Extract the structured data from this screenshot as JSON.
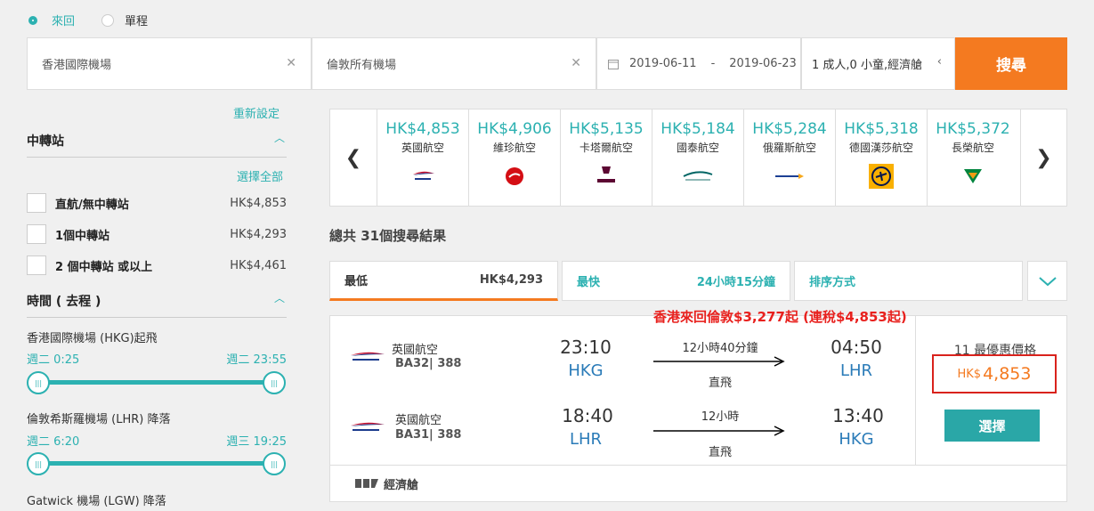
{
  "trip_type": {
    "round": "來回",
    "oneway": "單程"
  },
  "search": {
    "from": "香港國際機場",
    "to": "倫敦所有機場",
    "depart": "2019-06-11",
    "sep": "-",
    "return": "2019-06-23",
    "pax": "1 成人,0 小童,經濟艙",
    "button": "搜尋"
  },
  "sidebar": {
    "reset": "重新設定",
    "stops_title": "中轉站",
    "select_all": "選擇全部",
    "stops": [
      {
        "label": "直航/無中轉站",
        "price": "HK$4,853"
      },
      {
        "label": "1個中轉站",
        "price": "HK$4,293"
      },
      {
        "label": "2 個中轉站 或以上",
        "price": "HK$4,461"
      }
    ],
    "time_title": "時間 ( 去程 )",
    "sliders": [
      {
        "label": "香港國際機場 (HKG)起飛",
        "min": "週二 0:25",
        "max": "週二 23:55"
      },
      {
        "label": "倫敦希斯羅機場 (LHR) 降落",
        "min": "週二 6:20",
        "max": "週三 19:25"
      }
    ],
    "gatwick": "Gatwick 機場 (LGW) 降落"
  },
  "airlines": [
    {
      "price": "HK$4,853",
      "name": "英國航空",
      "logo": "ba-logo"
    },
    {
      "price": "HK$4,906",
      "name": "維珍航空",
      "logo": "virgin-logo"
    },
    {
      "price": "HK$5,135",
      "name": "卡塔爾航空",
      "logo": "qatar-logo"
    },
    {
      "price": "HK$5,184",
      "name": "國泰航空",
      "logo": "cathay-logo"
    },
    {
      "price": "HK$5,284",
      "name": "俄羅斯航空",
      "logo": "aeroflot-logo"
    },
    {
      "price": "HK$5,318",
      "name": "德國漢莎航空",
      "logo": "lufthansa-logo"
    },
    {
      "price": "HK$5,372",
      "name": "長榮航空",
      "logo": "eva-logo"
    }
  ],
  "results_count": "總共 31個搜尋結果",
  "sort": {
    "cheapest_label": "最低",
    "cheapest_value": "HK$4,293",
    "fastest_label": "最快",
    "fastest_value": "24小時15分鐘",
    "sort_label": "排序方式"
  },
  "promo": "香港來回倫敦$3,277起 (連稅$4,853起)",
  "result": {
    "legs": [
      {
        "airline": "英國航空",
        "code": "BA32| 388",
        "dep_time": "23:10",
        "dep_ap": "HKG",
        "duration": "12小時40分鐘",
        "stops": "直飛",
        "arr_time": "04:50",
        "arr_ap": "LHR"
      },
      {
        "airline": "英國航空",
        "code": "BA31| 388",
        "dep_time": "18:40",
        "dep_ap": "LHR",
        "duration": "12小時",
        "stops": "直飛",
        "arr_time": "13:40",
        "arr_ap": "HKG"
      }
    ],
    "best_price_label": "11 最優惠價格",
    "currency": "HK$",
    "amount": "4,853",
    "select": "選擇",
    "cabin": "經濟艙"
  },
  "colors": {
    "teal": "#2cb1b1",
    "orange": "#f47a20",
    "red": "#e8211e"
  }
}
